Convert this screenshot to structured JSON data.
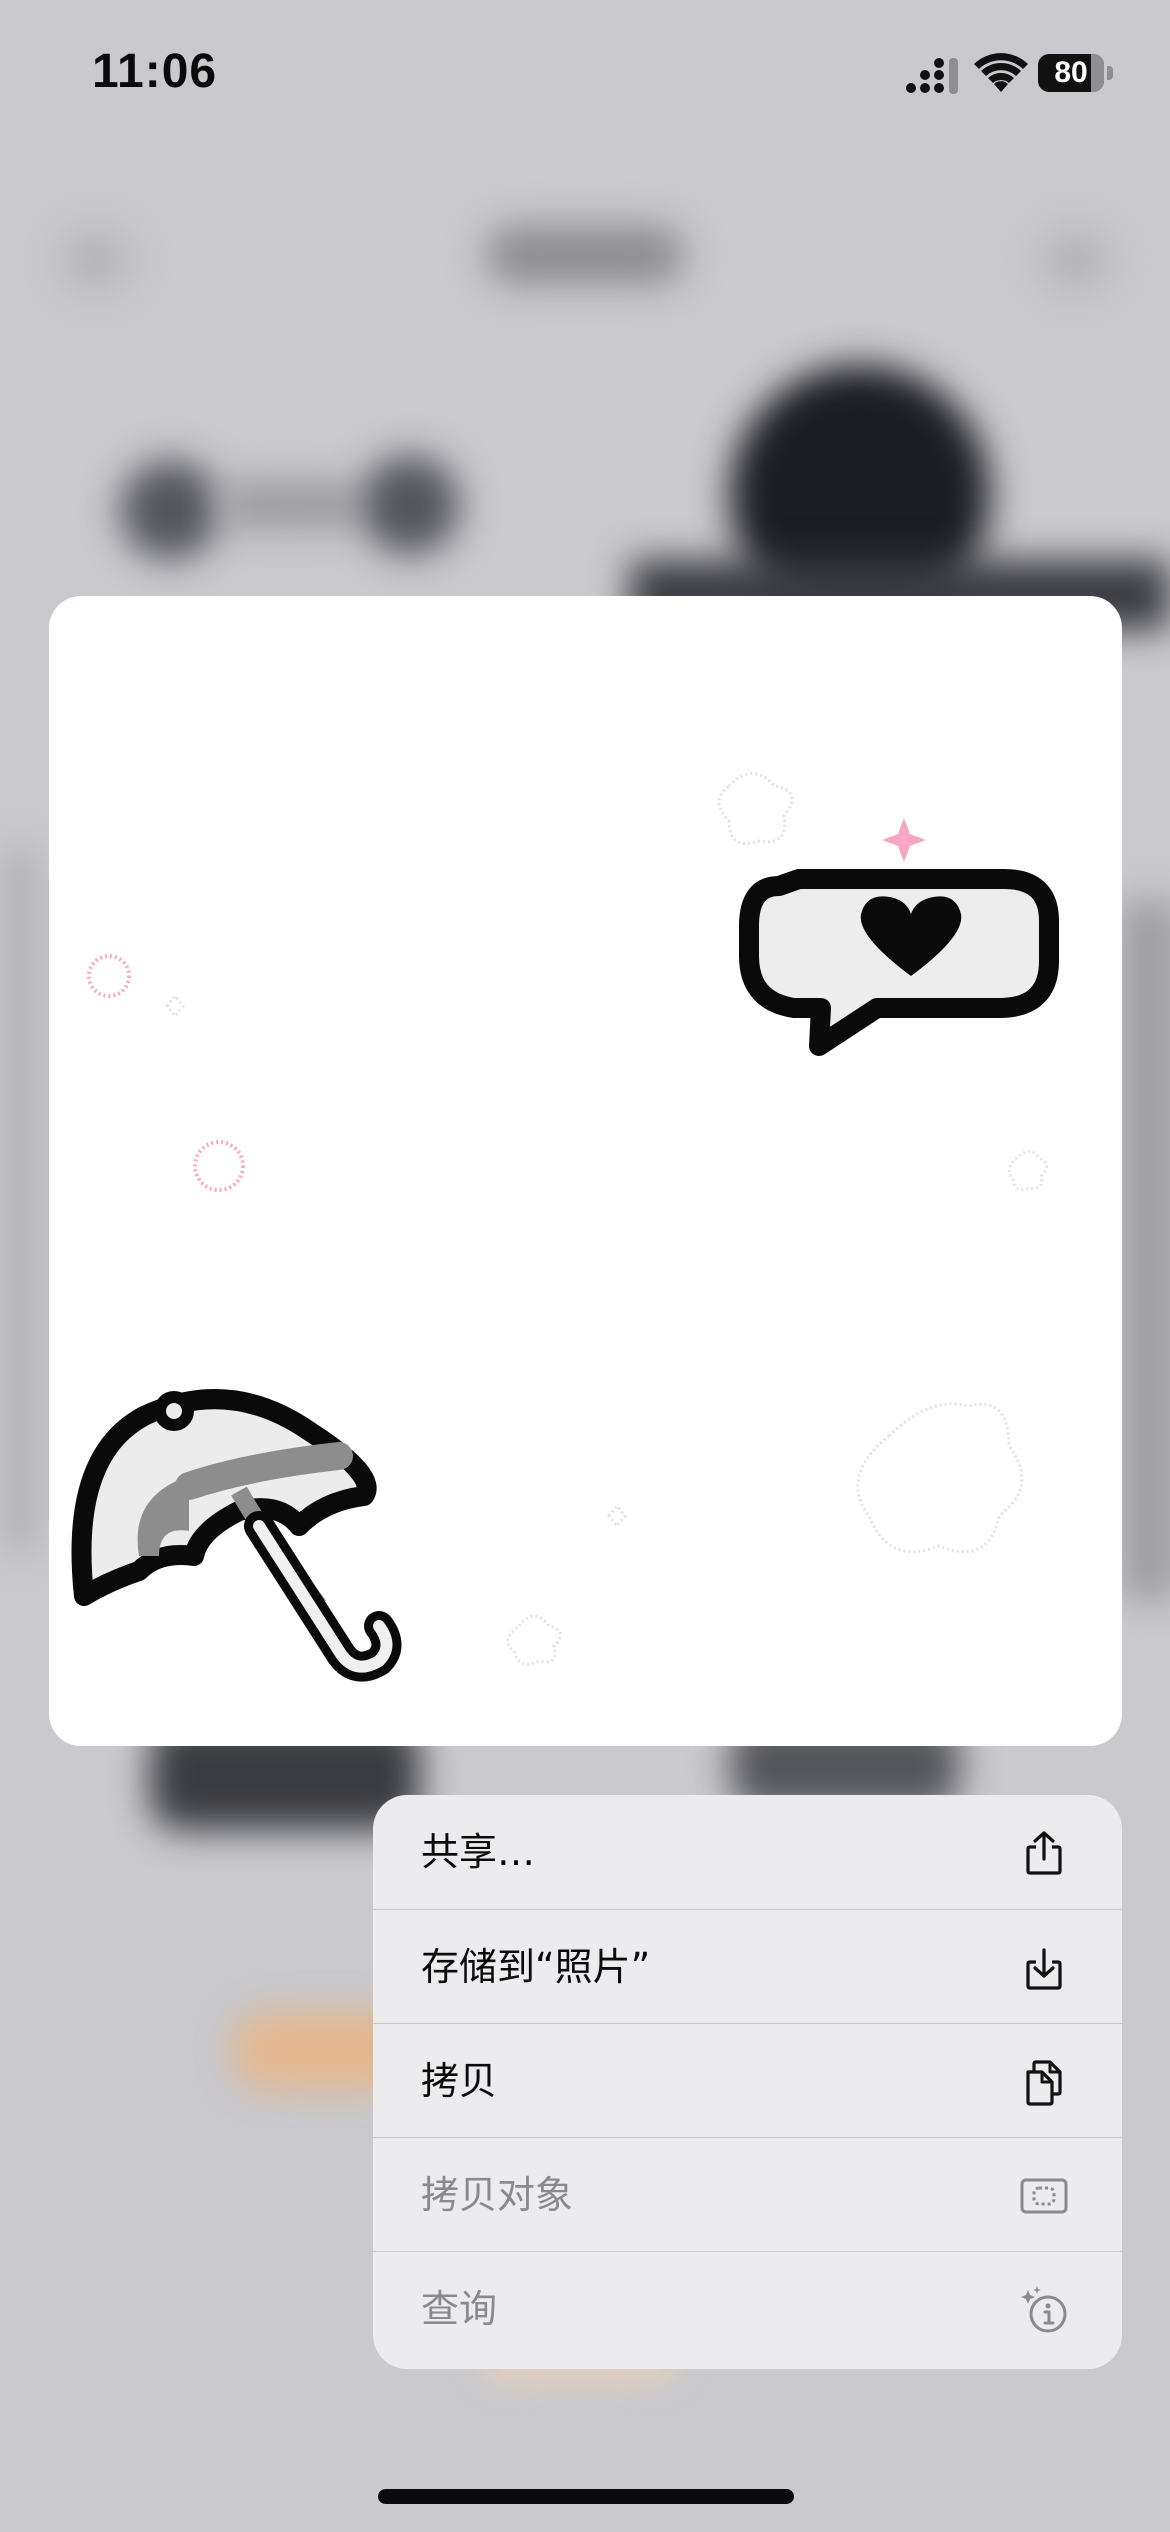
{
  "status_bar": {
    "time": "11:06",
    "battery_level": "80",
    "battery_fraction": 0.8,
    "signal_icon": "cellular-signal-icon",
    "wifi_icon": "wifi-icon"
  },
  "preview": {
    "description_icons": [
      "speech-bubble-heart-icon",
      "umbrella-icon",
      "sparkle-icon"
    ],
    "accent_pink": "#f5a8c8"
  },
  "context_menu": {
    "items": [
      {
        "label": "共享…",
        "icon": "share-icon",
        "enabled": true
      },
      {
        "label": "存储到“照片”",
        "icon": "save-download-icon",
        "enabled": true
      },
      {
        "label": "拷贝",
        "icon": "copy-icon",
        "enabled": true
      },
      {
        "label": "拷贝对象",
        "icon": "copy-subject-icon",
        "enabled": false
      },
      {
        "label": "查询",
        "icon": "look-up-icon",
        "enabled": false
      }
    ]
  },
  "colors": {
    "menu_background": "#ececef",
    "disabled_text": "#8a8a8e",
    "enabled_text": "#0b0b0b"
  }
}
